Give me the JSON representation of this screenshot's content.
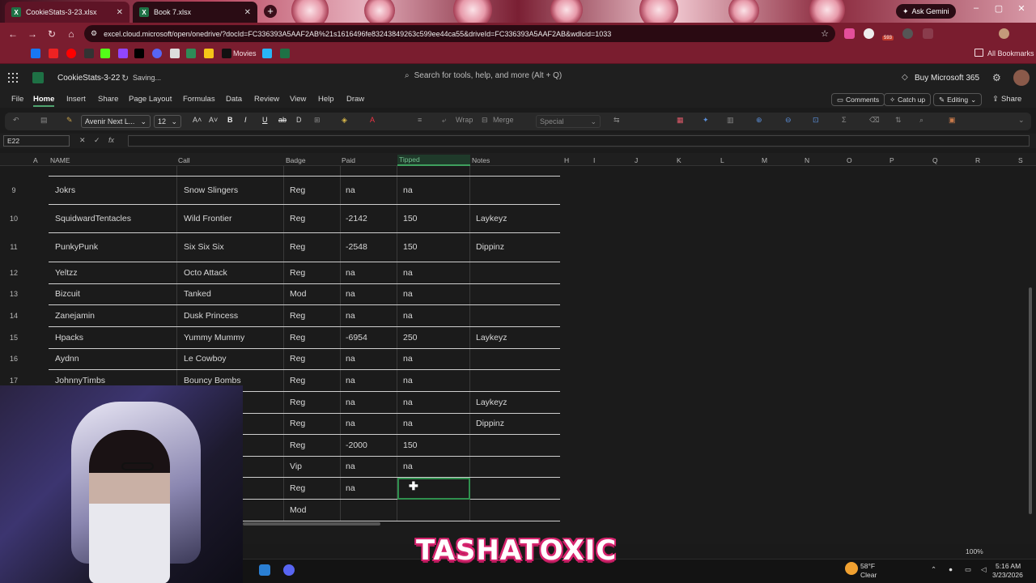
{
  "browser": {
    "tabs": [
      {
        "title": "CookieStats-3-23.xlsx",
        "close": "✕"
      },
      {
        "title": "Book 7.xlsx",
        "close": "✕"
      }
    ],
    "new_tab": "+",
    "gemini_label": "Ask Gemini",
    "url": "excel.cloud.microsoft/open/onedrive/?docId=FC336393A5AAF2AB%21s1616496fe83243849263c599ee44ca55&driveId=FC336393A5AAF2AB&wdlcid=1033",
    "extension_badge": "593",
    "bookmarks_label": "Movies",
    "all_bookmarks": "All Bookmarks"
  },
  "excel": {
    "file_name": "CookieStats-3-22",
    "save_status": "Saving...",
    "search_placeholder": "Search for tools, help, and more (Alt + Q)",
    "buy_label": "Buy Microsoft 365",
    "menu": [
      "File",
      "Home",
      "Insert",
      "Share",
      "Page Layout",
      "Formulas",
      "Data",
      "Review",
      "View",
      "Help",
      "Draw"
    ],
    "active_menu": "Home",
    "comments_label": "Comments",
    "catchup_label": "Catch up",
    "editing_label": "Editing",
    "share_label": "Share",
    "font_name": "Avenir Next L...",
    "font_size": "12",
    "wrap_label": "Wrap",
    "merge_label": "Merge",
    "number_format": "Special",
    "name_box": "E22",
    "fx_label": "fx",
    "zoom": "100%"
  },
  "grid": {
    "columns": [
      "A",
      "NAME",
      "Call",
      "Badge",
      "Paid",
      "Tipped",
      "Notes",
      "H",
      "I",
      "J",
      "K",
      "L",
      "M",
      "N",
      "O",
      "P",
      "Q",
      "R",
      "S"
    ],
    "selected_column": "Tipped",
    "rows": [
      {
        "num": "9",
        "name": "Jokrs",
        "call": "Snow Slingers",
        "badge": "Reg",
        "paid": "na",
        "tipped": "na",
        "notes": ""
      },
      {
        "num": "10",
        "name": "SquidwardTentacles",
        "call": "Wild Frontier",
        "badge": "Reg",
        "paid": "-2142",
        "tipped": "150",
        "notes": "Laykeyz"
      },
      {
        "num": "11",
        "name": "PunkyPunk",
        "call": "Six Six Six",
        "badge": "Reg",
        "paid": "-2548",
        "tipped": "150",
        "notes": "Dippinz"
      },
      {
        "num": "12",
        "name": "Yeltzz",
        "call": "Octo Attack",
        "badge": "Reg",
        "paid": "na",
        "tipped": "na",
        "notes": ""
      },
      {
        "num": "13",
        "name": "Bizcuit",
        "call": "Tanked",
        "badge": "Mod",
        "paid": "na",
        "tipped": "na",
        "notes": ""
      },
      {
        "num": "14",
        "name": "Zanejamin",
        "call": "Dusk Princess",
        "badge": "Reg",
        "paid": "na",
        "tipped": "na",
        "notes": ""
      },
      {
        "num": "15",
        "name": "Hpacks",
        "call": "Yummy Mummy",
        "badge": "Reg",
        "paid": "-6954",
        "tipped": "250",
        "notes": "Laykeyz"
      },
      {
        "num": "16",
        "name": "Aydnn",
        "call": "Le Cowboy",
        "badge": "Reg",
        "paid": "na",
        "tipped": "na",
        "notes": ""
      },
      {
        "num": "17",
        "name": "JohnnyTimbs",
        "call": "Bouncy Bombs",
        "badge": "Reg",
        "paid": "na",
        "tipped": "na",
        "notes": ""
      },
      {
        "num": "",
        "name": "",
        "call": "",
        "badge": "Reg",
        "paid": "na",
        "tipped": "na",
        "notes": "Laykeyz"
      },
      {
        "num": "",
        "name": "",
        "call": "",
        "badge": "Reg",
        "paid": "na",
        "tipped": "na",
        "notes": "Dippinz"
      },
      {
        "num": "",
        "name": "",
        "call": "",
        "badge": "Reg",
        "paid": "-2000",
        "tipped": "150",
        "notes": ""
      },
      {
        "num": "",
        "name": "",
        "call": "enge",
        "badge": "Vip",
        "paid": "na",
        "tipped": "na",
        "notes": ""
      },
      {
        "num": "",
        "name": "",
        "call": "",
        "badge": "Reg",
        "paid": "na",
        "tipped": "",
        "notes": ""
      },
      {
        "num": "",
        "name": "",
        "call": "",
        "badge": "Mod",
        "paid": "",
        "tipped": "",
        "notes": ""
      }
    ]
  },
  "overlay": {
    "brand_text": "TASHATOXIC"
  },
  "taskbar": {
    "temperature": "58°F",
    "weather": "Clear",
    "time": "5:16 AM",
    "date": "3/23/2026"
  },
  "colors": {
    "accent_green": "#2f8f4e",
    "browser_frame": "#7a1d2f",
    "brand_pink": "#d6246e"
  }
}
